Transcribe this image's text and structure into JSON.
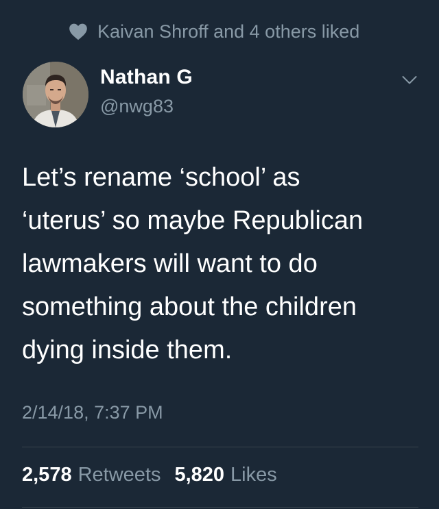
{
  "social_context": {
    "icon": "heart-icon",
    "text": "Kaivan Shroff and 4 others liked"
  },
  "author": {
    "name": "Nathan G",
    "handle": "@nwg83"
  },
  "tweet": {
    "lines": [
      "Let’s rename ‘school’ as",
      "‘uterus’ so maybe Republican",
      "lawmakers will want to do",
      "something about the children",
      "dying inside them."
    ],
    "timestamp": "2/14/18, 7:37 PM"
  },
  "stats": {
    "retweets_count": "2,578",
    "retweets_label": "Retweets",
    "likes_count": "5,820",
    "likes_label": "Likes"
  },
  "colors": {
    "background": "#1b2836",
    "text_primary": "#ffffff",
    "text_secondary": "#8899a6",
    "divider": "#38444d"
  }
}
